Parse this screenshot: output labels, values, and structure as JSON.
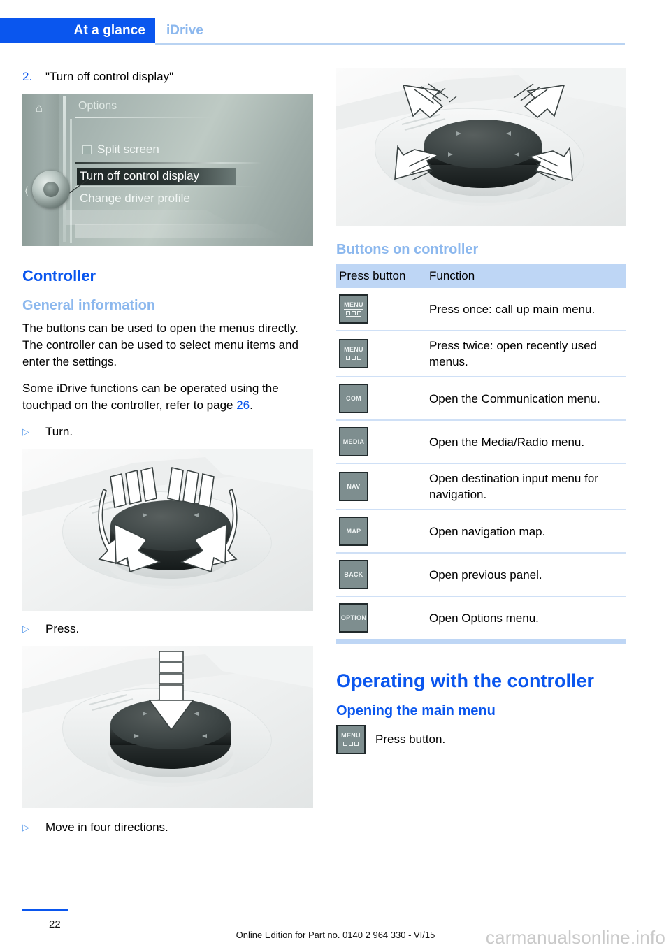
{
  "header": {
    "active_tab": "At a glance",
    "sub_tab": "iDrive",
    "accent_color": "#0a56ee",
    "sub_color": "#8cb8ee"
  },
  "left_column": {
    "step": {
      "number": "2.",
      "text": "\"Turn off control display\""
    },
    "idrive_screen": {
      "name": "idrive-options-screen",
      "home_icon": "home-icon",
      "title": "Options",
      "items": [
        {
          "label": "Split screen",
          "checkbox": true,
          "highlighted": false
        },
        {
          "label": "Turn off control display",
          "checkbox": false,
          "highlighted": true
        },
        {
          "label": "Change driver profile",
          "checkbox": false,
          "highlighted": false
        }
      ],
      "back_icon": "chevron-left-icon"
    },
    "section_title": "Controller",
    "subsection_title": "General information",
    "paragraphs": [
      "The buttons can be used to open the menus directly. The controller can be used to select menu items and enter the settings.",
      "Some iDrive functions can be operated using the touchpad on the controller, refer to page "
    ],
    "page_reference": "26",
    "page_reference_suffix": ".",
    "bullets": [
      {
        "mark": "▷",
        "text": "Turn."
      },
      {
        "mark": "▷",
        "text": "Press."
      },
      {
        "mark": "▷",
        "text": "Move in four directions."
      }
    ],
    "figures": [
      {
        "name": "controller-turn-photo",
        "caption_after": "Press."
      },
      {
        "name": "controller-press-photo",
        "caption_after": "Move in four directions."
      }
    ]
  },
  "right_column": {
    "top_figure": {
      "name": "controller-move-four-directions-photo"
    },
    "section_title": "Buttons on controller",
    "table": {
      "headers": [
        "Press button",
        "Function"
      ],
      "rows": [
        {
          "button": "MENU",
          "style": "menu",
          "function": "Press once: call up main menu."
        },
        {
          "button": "MENU",
          "style": "menu",
          "function": "Press twice: open recently used menus."
        },
        {
          "button": "COM",
          "style": "plain",
          "function": "Open the Communication menu."
        },
        {
          "button": "MEDIA",
          "style": "plain",
          "function": "Open the Media/Radio menu."
        },
        {
          "button": "NAV",
          "style": "plain",
          "function": "Open destination input menu for navigation."
        },
        {
          "button": "MAP",
          "style": "plain",
          "function": "Open navigation map."
        },
        {
          "button": "BACK",
          "style": "plain",
          "function": "Open previous panel."
        },
        {
          "button": "OPTION",
          "style": "plain",
          "function": "Open Options menu."
        }
      ],
      "header_bg": "#bed6f5",
      "row_divider": "#cfe0f6"
    },
    "big_heading": "Operating with the controller",
    "sub_heading": "Opening the main menu",
    "menu_instruction": {
      "button": "MENU",
      "text": "Press button."
    }
  },
  "footer": {
    "page_number": "22",
    "edition_note": "Online Edition for Part no. 0140 2 964 330 - VI/15",
    "watermark": "carmanualsonline.info"
  }
}
